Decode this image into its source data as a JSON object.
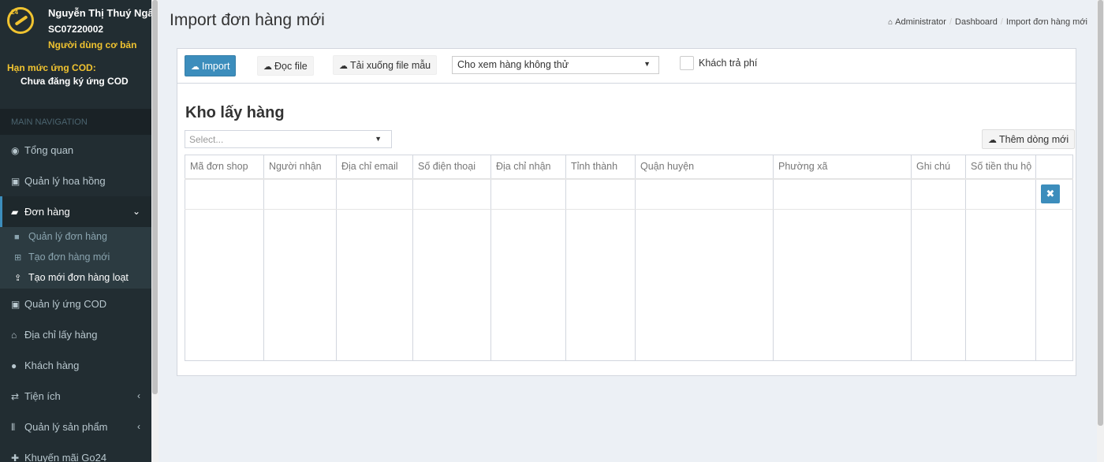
{
  "user": {
    "name": "Nguyễn Thị Thuý Ngân",
    "code": "SC07220002",
    "role": "Người dùng cơ bản"
  },
  "cod_limit": {
    "title": "Hạn mức ứng COD:",
    "value": "Chưa đăng ký ứng COD"
  },
  "nav": {
    "header": "MAIN NAVIGATION",
    "items": [
      {
        "label": "Tổng quan",
        "icon": "dashboard-icon"
      },
      {
        "label": "Quản lý hoa hồng",
        "icon": "money-icon"
      },
      {
        "label": "Đơn hàng",
        "icon": "briefcase-icon"
      },
      {
        "label": "Quản lý ứng COD",
        "icon": "money-icon"
      },
      {
        "label": "Địa chỉ lấy hàng",
        "icon": "bank-icon"
      },
      {
        "label": "Khách hàng",
        "icon": "user-icon"
      },
      {
        "label": "Tiện ích",
        "icon": "exchange-icon"
      },
      {
        "label": "Quản lý sản phẩm",
        "icon": "barcode-icon"
      },
      {
        "label": "Khuyến mãi Go24",
        "icon": "gift-icon"
      }
    ],
    "sub_items": [
      {
        "label": "Quản lý đơn hàng",
        "icon": "truck-icon"
      },
      {
        "label": "Tạo đơn hàng mới",
        "icon": "cart-icon"
      },
      {
        "label": "Tạo mới đơn hàng loạt",
        "icon": "upload-icon"
      }
    ]
  },
  "page": {
    "title": "Import đơn hàng mới",
    "breadcrumb": [
      "Administrator",
      "Dashboard",
      "Import đơn hàng mới"
    ]
  },
  "toolbar": {
    "import_label": "Import",
    "read_label": "Đọc file",
    "download_label": "Tải xuống file mẫu",
    "show_select_value": "Cho xem hàng không thử",
    "customer_pays_label": "Khách trả phí"
  },
  "warehouse": {
    "title": "Kho lấy hàng",
    "placeholder": "Select...",
    "add_row_label": "Thêm dòng mới"
  },
  "table": {
    "columns": [
      "Mã đơn shop",
      "Người nhận",
      "Địa chỉ email",
      "Số điện thoại",
      "Địa chỉ nhận",
      "Tỉnh thành",
      "Quận huyện",
      "Phường xã",
      "Ghi chú",
      "Số tiền thu hộ",
      ""
    ],
    "delete_symbol": "✖"
  },
  "colors": {
    "sidebar_bg": "#222d32",
    "accent": "#3c8dbc",
    "highlight": "#f0c330"
  }
}
